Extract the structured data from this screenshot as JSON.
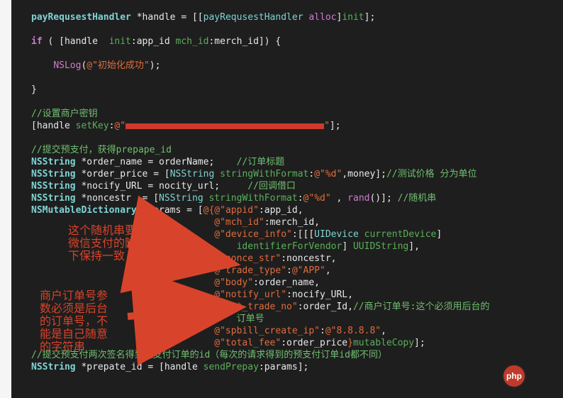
{
  "code": {
    "l01": {
      "a": "payRequsestHandler",
      "b": " *handle = [[",
      "c": "payRequsestHandler",
      "d": " ",
      "e": "alloc",
      "f": "]",
      "g": "init",
      "h": "];"
    },
    "l02": {
      "a": "if",
      "b": " ( [handle  ",
      "c": "init",
      "d": ":app_id ",
      "e": "mch_id",
      "f": ":merch_id]) {"
    },
    "l03": {
      "a": "NSLog",
      "b": "(",
      "c": "@\"初始化成功\"",
      "d": ");"
    },
    "l04": "}",
    "l05": "//设置商户密钥",
    "l06": {
      "a": "[handle ",
      "b": "setKey",
      "c": ":",
      "d": "@\"",
      "e": "\"",
      "f": "];"
    },
    "l07": "//提交预支付，获得prepape_id",
    "l08": {
      "a": "NSString",
      "b": " *order_name = orderName;    ",
      "c": "//订单标题"
    },
    "l09": {
      "a": "NSString",
      "b": " *order_price = [",
      "c": "NSString",
      "d": " ",
      "e": "stringWithFormat",
      "f": ":",
      "g": "@\"%d\"",
      "h": ",money];",
      "i": "//测试价格 分为单位"
    },
    "l10": {
      "a": "NSString",
      "b": " *nocify_URL = nocity_url;     ",
      "c": "//回调借口"
    },
    "l11": {
      "a": "NSString",
      "b": " *noncestr  = [",
      "c": "NSString",
      "d": " ",
      "e": "stringWithFormat",
      "f": ":",
      "g": "@\"%d\"",
      "h": " , ",
      "i": "rand",
      "j": "()]; ",
      "k": "//随机串"
    },
    "l12": {
      "a": "NSMutableDictionary",
      "b": " *params = [",
      "c": "@{",
      "d": "@\"appid\"",
      "e": ":app_id,"
    },
    "l13": {
      "a": "@\"mch_id\"",
      "b": ":merch_id,"
    },
    "l14": {
      "a": "@\"device_info\"",
      "b": ":[[[",
      "c": "UIDevice",
      "d": " ",
      "e": "currentDevice",
      "f": "]"
    },
    "l15": {
      "a": "identifierForVendor",
      "b": "] ",
      "c": "UUIDString",
      "d": "],"
    },
    "l16": {
      "a": "@\"nonce_str\"",
      "b": ":noncestr,"
    },
    "l17": {
      "a": "@\"trade_type\"",
      "b": ":",
      "c": "@\"APP\"",
      "d": ","
    },
    "l18": {
      "a": "@\"body\"",
      "b": ":order_name,"
    },
    "l19": {
      "a": "@\"notify_url\"",
      "b": ":nocify_URL,"
    },
    "l20": {
      "a": "@\"out_trade_no\"",
      "b": ":order_Id,",
      "c": "//商户订单号:这个必须用后台的"
    },
    "l20b": "订单号",
    "l21": {
      "a": "@\"spbill_create_ip\"",
      "b": ":",
      "c": "@\"8.8.8.8\"",
      "d": ","
    },
    "l22": {
      "a": "@\"total_fee\"",
      "b": ":order_price",
      "c": "}",
      "d": "mutableCopy",
      "e": "];"
    },
    "l23": "//提交预支付两次签名得到预支付订单的id（每次的请求得到的预支付订单id都不同）",
    "l24": {
      "a": "NSString",
      "b": " *prepate_id = [handle ",
      "c": "sendPrepay",
      "d": ":params];"
    }
  },
  "annotations": {
    "top": "这个随机串要跟调起\n微信支付的随机串上\n下保持一致",
    "bottom": "商户订单号参\n数必须是后台\n的订单号，不\n能是自己随意\n的字符串"
  },
  "logo": "php"
}
